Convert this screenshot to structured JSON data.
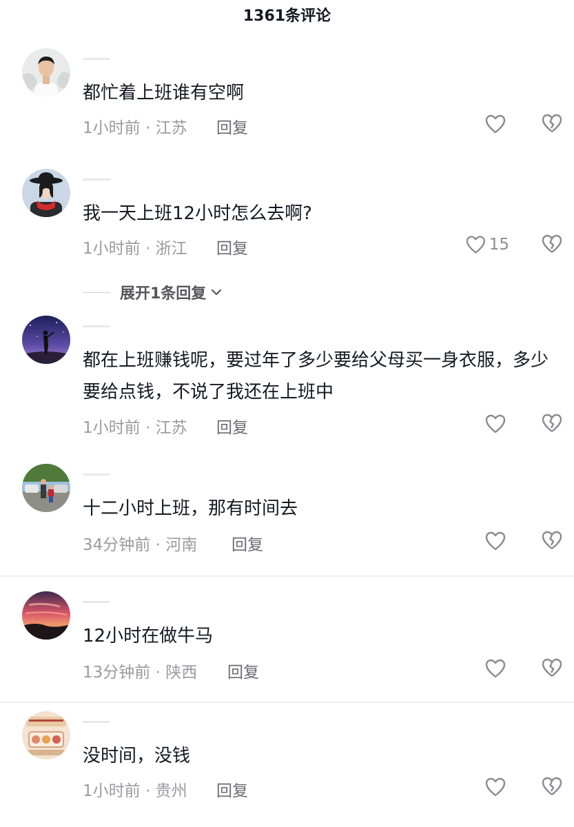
{
  "header": {
    "title": "1361条评论"
  },
  "reply_label": "回复",
  "expand": {
    "label": "展开1条回复"
  },
  "colors": {
    "text": "#161823",
    "meta": "#9a9aa1",
    "icon": "#8a8a92"
  },
  "comments": [
    {
      "text": "都忙着上班谁有空啊",
      "time": "1小时前 · 江苏",
      "likes": "",
      "avatar": "man-white-shirt"
    },
    {
      "text": "我一天上班12小时怎么去啊?",
      "time": "1小时前 · 浙江",
      "likes": "15",
      "avatar": "woman-red-scarf"
    },
    {
      "text": "都在上班赚钱呢，要过年了多少要给父母买一身衣服，多少要给点钱，不说了我还在上班中",
      "time": "1小时前 · 江苏",
      "likes": "",
      "avatar": "silhouette-night-sky"
    },
    {
      "text": "十二小时上班，那有时间去",
      "time": "34分钟前 · 河南",
      "likes": "",
      "avatar": "family-outdoor"
    },
    {
      "text": "12小时在做牛马",
      "time": "13分钟前 · 陕西",
      "likes": "",
      "avatar": "sunset-sky"
    },
    {
      "text": "没时间，没钱",
      "time": "1小时前 · 贵州",
      "likes": "",
      "avatar": "cartoon-sticker"
    }
  ]
}
